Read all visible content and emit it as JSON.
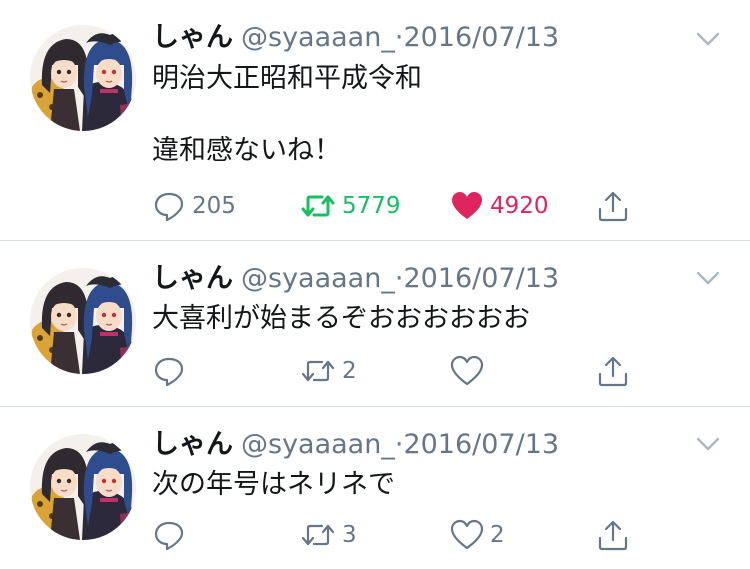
{
  "tweets": [
    {
      "name": "しゃん",
      "handle": "@syaaaan_",
      "separator": "·",
      "date": "2016/07/13",
      "text": "明治大正昭和平成令和\n\n違和感ないね！",
      "reply_count": "205",
      "retweet_count": "5779",
      "like_count": "4920",
      "retweeted": true,
      "liked": true
    },
    {
      "name": "しゃん",
      "handle": "@syaaaan_",
      "separator": "·",
      "date": "2016/07/13",
      "text": "大喜利が始まるぞおおおおおお",
      "reply_count": "",
      "retweet_count": "2",
      "like_count": "",
      "retweeted": false,
      "liked": false
    },
    {
      "name": "しゃん",
      "handle": "@syaaaan_",
      "separator": "·",
      "date": "2016/07/13",
      "text": "次の年号はネリネで",
      "reply_count": "",
      "retweet_count": "3",
      "like_count": "2",
      "retweeted": false,
      "liked": false
    }
  ],
  "icons": {
    "reply": "speech-bubble-icon",
    "retweet": "retweet-arrows-icon",
    "like": "heart-icon",
    "share": "share-upload-icon",
    "menu": "chevron-down-icon"
  },
  "colors": {
    "text": "#14171a",
    "secondary": "#657786",
    "divider": "#d8dde2",
    "retweet_active": "#17bf63",
    "like_active": "#e0245e",
    "chevron": "#aab8c2"
  }
}
